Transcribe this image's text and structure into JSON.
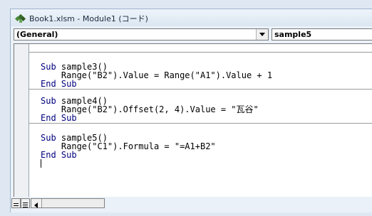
{
  "window": {
    "title": "Book1.xlsm - Module1 (コード)"
  },
  "toolbar": {
    "object_combo": "(General)",
    "procedure_combo": "sample5"
  },
  "code": {
    "blocks": [
      {
        "lines": [
          {
            "kw": "Sub",
            "text": " sample3()"
          },
          {
            "kw": "",
            "text": "    Range(\"B2\").Value = Range(\"A1\").Value + 1"
          },
          {
            "kw": "End Sub",
            "text": ""
          }
        ]
      },
      {
        "lines": [
          {
            "kw": "Sub",
            "text": " sample4()"
          },
          {
            "kw": "",
            "text": "    Range(\"B2\").Offset(2, 4).Value = \"瓦谷\""
          },
          {
            "kw": "End Sub",
            "text": ""
          }
        ]
      },
      {
        "lines": [
          {
            "kw": "Sub",
            "text": " sample5()"
          },
          {
            "kw": "",
            "text": "    Range(\"C1\").Formula = \"=A1+B2\""
          },
          {
            "kw": "End Sub",
            "text": ""
          }
        ]
      }
    ]
  },
  "colors": {
    "keyword": "#00007f",
    "text": "#000000"
  },
  "icons": {
    "title": "vba-module-icon",
    "dropdown": "chevron-down-icon",
    "procedure_view": "procedure-view-icon",
    "full_module_view": "full-module-view-icon",
    "scroll_left": "arrow-left-icon"
  }
}
